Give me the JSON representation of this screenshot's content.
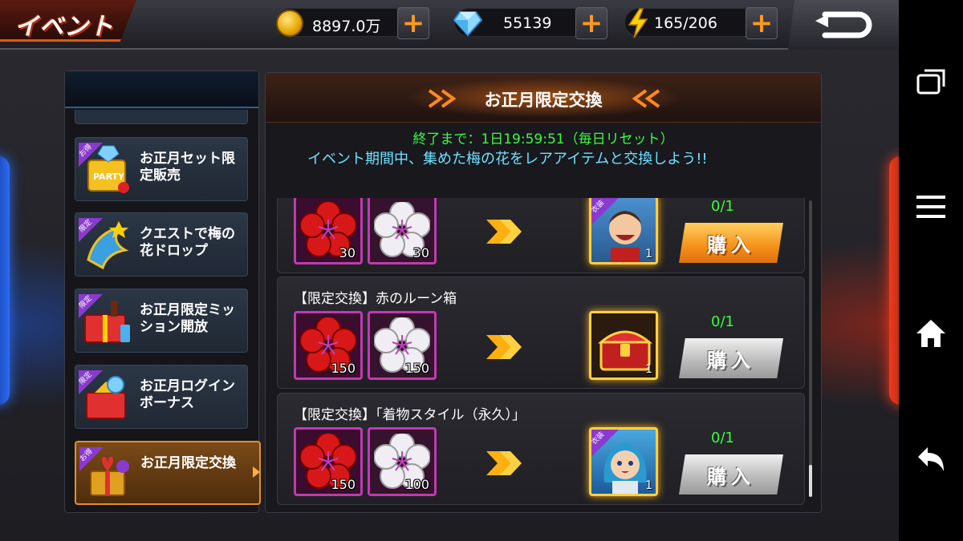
{
  "header": {
    "title": "イベント",
    "resources": [
      {
        "name": "coin",
        "value": "8897.0万"
      },
      {
        "name": "gem",
        "value": "55139"
      },
      {
        "name": "stamina",
        "value": "165/206"
      }
    ],
    "plus": "+"
  },
  "sidebar": {
    "items": [
      {
        "label": "お正月セット限定販売",
        "badge": "お得",
        "active": false
      },
      {
        "label": "クエストで梅の花ドロップ",
        "badge": "限定",
        "active": false
      },
      {
        "label": "お正月限定ミッション開放",
        "badge": "限定",
        "active": false
      },
      {
        "label": "お正月ログインボーナス",
        "badge": "限定",
        "active": false
      },
      {
        "label": "お正月限定交換",
        "badge": "お得",
        "active": true
      }
    ]
  },
  "main": {
    "title": "お正月限定交換",
    "timer": "終了まで：1日19:59:51（毎日リセット）",
    "description": "イベント期間中、集めた梅の花をレアアイテムと交換しよう!!",
    "rows": [
      {
        "title": "",
        "cost_red": "30",
        "cost_white": "30",
        "reward_qty": "1",
        "reward_tag": "衣装",
        "count": "0/1",
        "buy_label": "購入",
        "buy_enabled": true
      },
      {
        "title": "【限定交換】赤のルーン箱",
        "cost_red": "150",
        "cost_white": "150",
        "reward_qty": "1",
        "reward_tag": "",
        "count": "0/1",
        "buy_label": "購入",
        "buy_enabled": false
      },
      {
        "title": "【限定交換】「着物スタイル（永久）」",
        "cost_red": "150",
        "cost_white": "100",
        "reward_qty": "1",
        "reward_tag": "衣装",
        "count": "0/1",
        "buy_label": "購入",
        "buy_enabled": false
      }
    ]
  },
  "colors": {
    "accent_orange": "#f59018",
    "timer_green": "#38ff3a",
    "desc_cyan": "#6fe1ff",
    "item_border": "#c03ab0"
  },
  "icons": [
    "coin-icon",
    "gem-icon",
    "lightning-icon",
    "back-icon",
    "plum-flower-icon",
    "double-chevron-icon",
    "recent-apps-icon",
    "menu-icon",
    "home-icon",
    "nav-back-icon"
  ]
}
